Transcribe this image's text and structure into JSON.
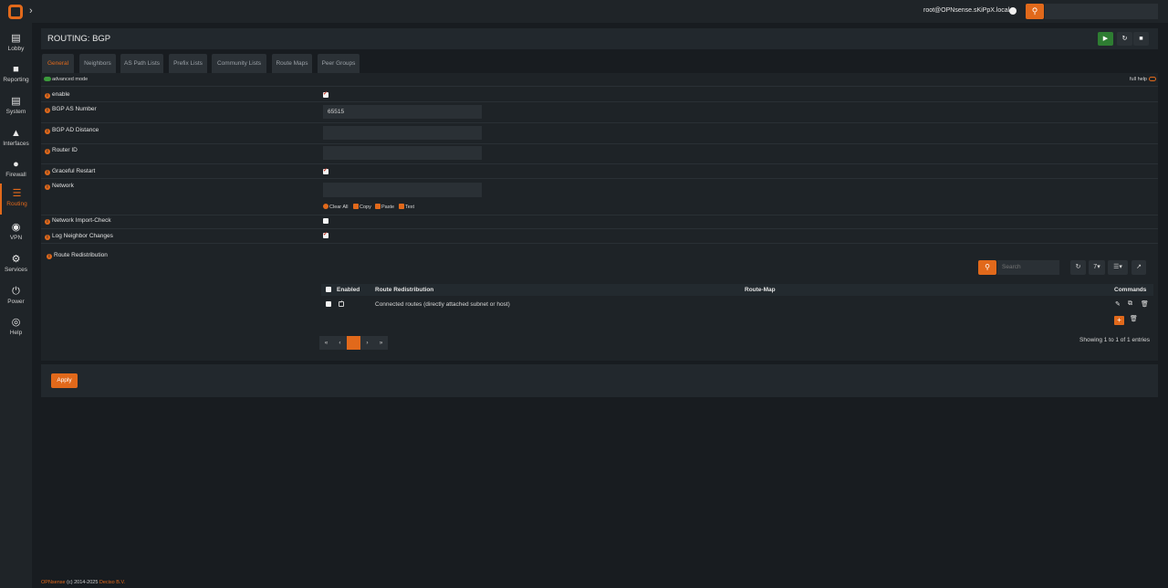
{
  "topbar": {
    "user": "root@OPNsense.sKiPpX.local",
    "search_placeholder": ""
  },
  "sidebar": {
    "items": [
      {
        "label": "Lobby",
        "icon": "laptop-icon"
      },
      {
        "label": "Reporting",
        "icon": "chart-icon"
      },
      {
        "label": "System",
        "icon": "server-icon"
      },
      {
        "label": "Interfaces",
        "icon": "sitemap-icon"
      },
      {
        "label": "Firewall",
        "icon": "fire-icon"
      },
      {
        "label": "Routing",
        "icon": "signs-icon"
      },
      {
        "label": "VPN",
        "icon": "globe-icon"
      },
      {
        "label": "Services",
        "icon": "gear-icon"
      },
      {
        "label": "Power",
        "icon": "plug-icon"
      },
      {
        "label": "Help",
        "icon": "lifebuoy-icon"
      }
    ],
    "active": "Routing"
  },
  "header": {
    "title": "ROUTING: BGP",
    "buttons": [
      "play-icon",
      "reload-icon",
      "stop-icon"
    ]
  },
  "tabs": [
    "General",
    "Neighbors",
    "AS Path Lists",
    "Prefix Lists",
    "Community Lists",
    "Route Maps",
    "Peer Groups"
  ],
  "active_tab": "General",
  "mode": {
    "advanced": "advanced mode",
    "full_help": "full help"
  },
  "form": {
    "enable": {
      "label": "enable",
      "checked": true
    },
    "as_number": {
      "label": "BGP AS Number",
      "value": "65515"
    },
    "ad_distance": {
      "label": "BGP AD Distance",
      "value": ""
    },
    "router_id": {
      "label": "Router ID",
      "value": ""
    },
    "graceful_restart": {
      "label": "Graceful Restart",
      "checked": true
    },
    "network": {
      "label": "Network",
      "value": ""
    },
    "network_tools": {
      "clear_all": "Clear All",
      "copy": "Copy",
      "paste": "Paste",
      "text": "Text"
    },
    "import_check": {
      "label": "Network Import-Check",
      "checked": false
    },
    "log_neighbor": {
      "label": "Log Neighbor Changes",
      "checked": true
    },
    "route_redistribution": {
      "label": "Route Redistribution"
    }
  },
  "grid": {
    "search_placeholder": "Search",
    "page_size": "7",
    "columns": [
      "Enabled",
      "Route Redistribution",
      "Route-Map",
      "Commands"
    ],
    "rows": [
      {
        "enabled": true,
        "route_redistribution": "Connected routes (directly attached subnet or host)",
        "route_map": ""
      }
    ],
    "pagination": [
      "«",
      "‹",
      "1",
      "›",
      "»"
    ],
    "current_page": "1",
    "showing": "Showing 1 to 1 of 1 entries"
  },
  "apply": {
    "label": "Apply"
  },
  "footer": {
    "brand": "OPNsense",
    "copyright": "(c) 2014-2025",
    "company": "Deciso B.V."
  },
  "colors": {
    "accent": "#e1691b",
    "success": "#3c9a3c",
    "panel": "#22282d",
    "background": "#181c20"
  }
}
